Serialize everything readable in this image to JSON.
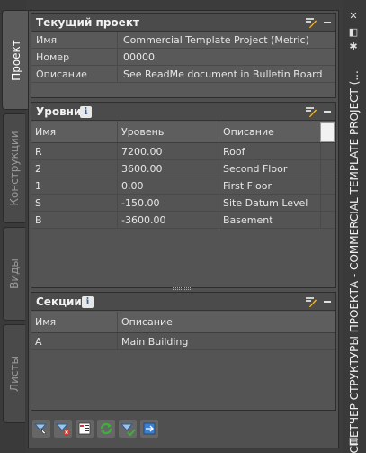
{
  "title_bar": {
    "title": "ДИСПЕТЧЕР СТРУКТУРЫ ПРОЕКТА - COMMERCIAL TEMPLATE PROJECT (..."
  },
  "tabs": [
    {
      "label": "Проект",
      "active": true
    },
    {
      "label": "Конструкции",
      "active": false
    },
    {
      "label": "Виды",
      "active": false
    },
    {
      "label": "Листы",
      "active": false
    }
  ],
  "current_project": {
    "title": "Текущий проект",
    "rows": [
      {
        "key": "Имя",
        "value": "Commercial Template Project (Metric)"
      },
      {
        "key": "Номер",
        "value": "00000"
      },
      {
        "key": "Описание",
        "value": "See ReadMe document in Bulletin Board"
      }
    ]
  },
  "levels": {
    "title": "Уровни",
    "columns": [
      "Имя",
      "Уровень",
      "Описание"
    ],
    "rows": [
      [
        "R",
        "7200.00",
        "Roof"
      ],
      [
        "2",
        "3600.00",
        "Second Floor"
      ],
      [
        "1",
        "0.00",
        "First Floor"
      ],
      [
        "S",
        "-150.00",
        "Site Datum Level"
      ],
      [
        "B",
        "-3600.00",
        "Basement"
      ]
    ]
  },
  "divisions": {
    "title": "Секции",
    "columns": [
      "Имя",
      "Описание"
    ],
    "rows": [
      [
        "A",
        "Main Building"
      ]
    ]
  },
  "icons": {
    "info": "i",
    "accent_green": "#3fae3a",
    "accent_blue": "#3a7fd0"
  }
}
